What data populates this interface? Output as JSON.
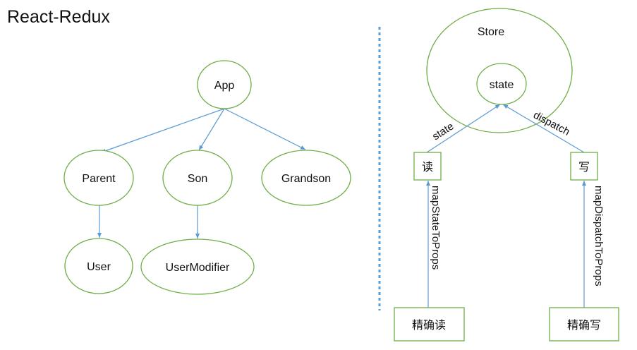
{
  "title": "React-Redux",
  "colors": {
    "node_stroke": "#70ad47",
    "edge": "#5b9bd5",
    "divider": "#5b9bd5"
  },
  "tree": {
    "app": "App",
    "parent": "Parent",
    "son": "Son",
    "grandson": "Grandson",
    "user": "User",
    "user_modifier": "UserModifier"
  },
  "redux": {
    "store": "Store",
    "state": "state",
    "read": "读",
    "write": "写",
    "precise_read": "精确读",
    "precise_write": "精确写",
    "edge_state": "state",
    "edge_dispatch": "dispatch",
    "edge_map_state": "mapStateToProps",
    "edge_map_dispatch": "mapDispatchToProps"
  }
}
